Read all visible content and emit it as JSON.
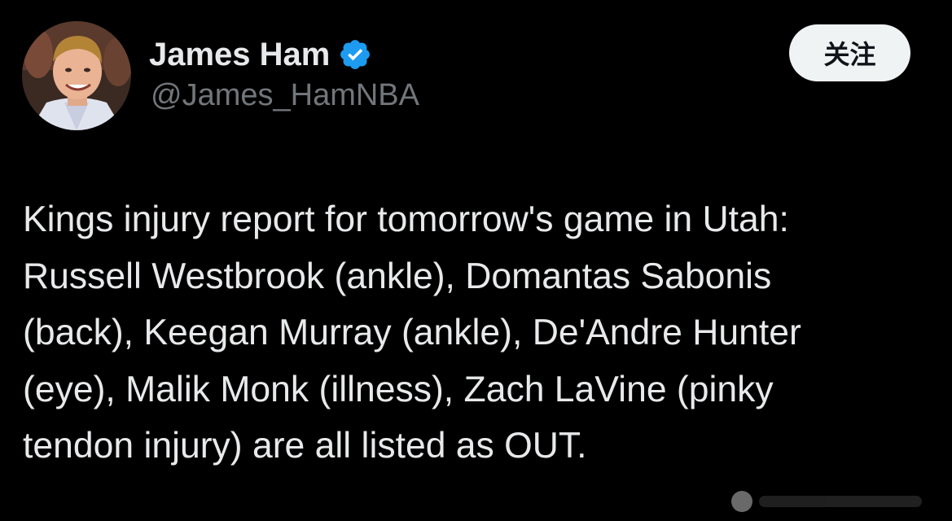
{
  "author": {
    "display_name": "James Ham",
    "handle": "@James_HamNBA",
    "verified": true
  },
  "follow_button": {
    "label": "关注"
  },
  "tweet": {
    "lines": [
      "Kings injury report for tomorrow's game in Utah:",
      "Russell Westbrook (ankle), Domantas Sabonis",
      "(back), Keegan Murray (ankle), De'Andre Hunter",
      "(eye), Malik Monk (illness), Zach LaVine (pinky",
      "tendon injury) are all listed as OUT."
    ]
  },
  "colors": {
    "background": "#000000",
    "text_primary": "#e7e9ea",
    "text_secondary": "#71767b",
    "verified_badge": "#1d9bf0",
    "follow_button_bg": "#eff3f4"
  },
  "icons": {
    "verified": "verified-badge-icon",
    "watermark": "watermark-icon"
  }
}
